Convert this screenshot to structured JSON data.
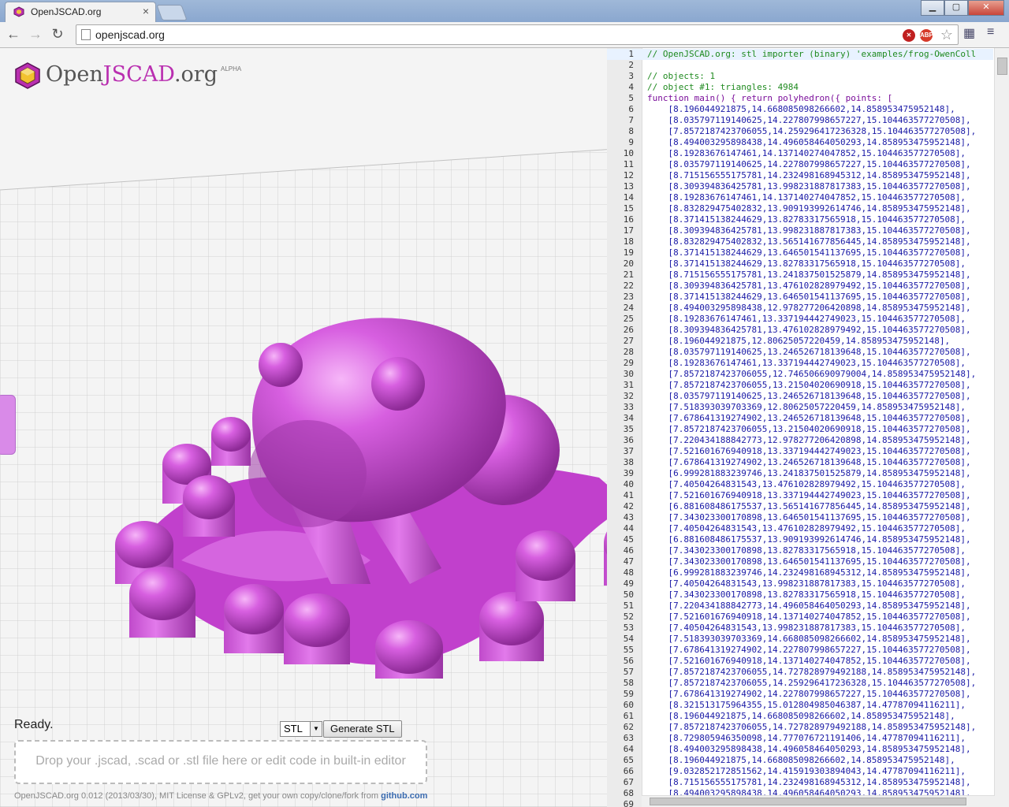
{
  "browser": {
    "tab_title": "OpenJSCAD.org",
    "url": "openjscad.org"
  },
  "logo": {
    "open": "Open",
    "jscad": "JSCAD",
    "org": ".org",
    "badge": "ALPHA"
  },
  "viewer": {
    "status": "Ready.",
    "format_selected": "STL",
    "generate_label": "Generate STL",
    "dropzone_text": "Drop your .jscad, .scad or .stl file here or edit code in built-in editor",
    "footer_text": "OpenJSCAD.org 0.012 (2013/03/30), MIT License & GPLv2, get your own copy/clone/fork from ",
    "footer_link": "github.com"
  },
  "editor": {
    "lines": [
      {
        "n": "1",
        "t": "// OpenJSCAD.org: stl importer (binary) 'examples/frog-OwenColl",
        "c": "comment"
      },
      {
        "n": "2",
        "t": "",
        "c": "plain"
      },
      {
        "n": "3",
        "t": "// objects: 1",
        "c": "comment"
      },
      {
        "n": "4",
        "t": "// object #1: triangles: 4984",
        "c": "comment"
      },
      {
        "n": "5",
        "t": "function main() { return polyhedron({ points: [",
        "c": "kw"
      },
      {
        "n": "6",
        "t": "    [8.196044921875,14.668085098266602,14.858953475952148],",
        "c": "num"
      },
      {
        "n": "7",
        "t": "    [8.035797119140625,14.227807998657227,15.104463577270508],",
        "c": "num"
      },
      {
        "n": "8",
        "t": "    [7.8572187423706055,14.259296417236328,15.104463577270508],",
        "c": "num"
      },
      {
        "n": "9",
        "t": "    [8.494003295898438,14.496058464050293,14.858953475952148],",
        "c": "num"
      },
      {
        "n": "10",
        "t": "    [8.19283676147461,14.137140274047852,15.104463577270508],",
        "c": "num"
      },
      {
        "n": "11",
        "t": "    [8.035797119140625,14.227807998657227,15.104463577270508],",
        "c": "num"
      },
      {
        "n": "12",
        "t": "    [8.715156555175781,14.232498168945312,14.858953475952148],",
        "c": "num"
      },
      {
        "n": "13",
        "t": "    [8.309394836425781,13.998231887817383,15.104463577270508],",
        "c": "num"
      },
      {
        "n": "14",
        "t": "    [8.19283676147461,14.137140274047852,15.104463577270508],",
        "c": "num"
      },
      {
        "n": "15",
        "t": "    [8.832829475402832,13.909193992614746,14.858953475952148],",
        "c": "num"
      },
      {
        "n": "16",
        "t": "    [8.371415138244629,13.82783317565918,15.104463577270508],",
        "c": "num"
      },
      {
        "n": "17",
        "t": "    [8.309394836425781,13.998231887817383,15.104463577270508],",
        "c": "num"
      },
      {
        "n": "18",
        "t": "    [8.832829475402832,13.565141677856445,14.858953475952148],",
        "c": "num"
      },
      {
        "n": "19",
        "t": "    [8.371415138244629,13.646501541137695,15.104463577270508],",
        "c": "num"
      },
      {
        "n": "20",
        "t": "    [8.371415138244629,13.82783317565918,15.104463577270508],",
        "c": "num"
      },
      {
        "n": "21",
        "t": "    [8.715156555175781,13.241837501525879,14.858953475952148],",
        "c": "num"
      },
      {
        "n": "22",
        "t": "    [8.309394836425781,13.476102828979492,15.104463577270508],",
        "c": "num"
      },
      {
        "n": "23",
        "t": "    [8.371415138244629,13.646501541137695,15.104463577270508],",
        "c": "num"
      },
      {
        "n": "24",
        "t": "    [8.494003295898438,12.978277206420898,14.858953475952148],",
        "c": "num"
      },
      {
        "n": "25",
        "t": "    [8.19283676147461,13.337194442749023,15.104463577270508],",
        "c": "num"
      },
      {
        "n": "26",
        "t": "    [8.309394836425781,13.476102828979492,15.104463577270508],",
        "c": "num"
      },
      {
        "n": "27",
        "t": "    [8.196044921875,12.80625057220459,14.858953475952148],",
        "c": "num"
      },
      {
        "n": "28",
        "t": "    [8.035797119140625,13.246526718139648,15.104463577270508],",
        "c": "num"
      },
      {
        "n": "29",
        "t": "    [8.19283676147461,13.337194442749023,15.104463577270508],",
        "c": "num"
      },
      {
        "n": "30",
        "t": "    [7.8572187423706055,12.746506690979004,14.858953475952148],",
        "c": "num"
      },
      {
        "n": "31",
        "t": "    [7.8572187423706055,13.21504020690918,15.104463577270508],",
        "c": "num"
      },
      {
        "n": "32",
        "t": "    [8.035797119140625,13.246526718139648,15.104463577270508],",
        "c": "num"
      },
      {
        "n": "33",
        "t": "    [7.518393039703369,12.80625057220459,14.858953475952148],",
        "c": "num"
      },
      {
        "n": "34",
        "t": "    [7.678641319274902,13.246526718139648,15.104463577270508],",
        "c": "num"
      },
      {
        "n": "35",
        "t": "    [7.8572187423706055,13.21504020690918,15.104463577270508],",
        "c": "num"
      },
      {
        "n": "36",
        "t": "    [7.220434188842773,12.978277206420898,14.858953475952148],",
        "c": "num"
      },
      {
        "n": "37",
        "t": "    [7.521601676940918,13.337194442749023,15.104463577270508],",
        "c": "num"
      },
      {
        "n": "38",
        "t": "    [7.678641319274902,13.246526718139648,15.104463577270508],",
        "c": "num"
      },
      {
        "n": "39",
        "t": "    [6.999281883239746,13.241837501525879,14.858953475952148],",
        "c": "num"
      },
      {
        "n": "40",
        "t": "    [7.40504264831543,13.476102828979492,15.104463577270508],",
        "c": "num"
      },
      {
        "n": "41",
        "t": "    [7.521601676940918,13.337194442749023,15.104463577270508],",
        "c": "num"
      },
      {
        "n": "42",
        "t": "    [6.881608486175537,13.565141677856445,14.858953475952148],",
        "c": "num"
      },
      {
        "n": "43",
        "t": "    [7.343023300170898,13.646501541137695,15.104463577270508],",
        "c": "num"
      },
      {
        "n": "44",
        "t": "    [7.40504264831543,13.476102828979492,15.104463577270508],",
        "c": "num"
      },
      {
        "n": "45",
        "t": "    [6.881608486175537,13.909193992614746,14.858953475952148],",
        "c": "num"
      },
      {
        "n": "46",
        "t": "    [7.343023300170898,13.82783317565918,15.104463577270508],",
        "c": "num"
      },
      {
        "n": "47",
        "t": "    [7.343023300170898,13.646501541137695,15.104463577270508],",
        "c": "num"
      },
      {
        "n": "48",
        "t": "    [6.999281883239746,14.232498168945312,14.858953475952148],",
        "c": "num"
      },
      {
        "n": "49",
        "t": "    [7.40504264831543,13.998231887817383,15.104463577270508],",
        "c": "num"
      },
      {
        "n": "50",
        "t": "    [7.343023300170898,13.82783317565918,15.104463577270508],",
        "c": "num"
      },
      {
        "n": "51",
        "t": "    [7.220434188842773,14.496058464050293,14.858953475952148],",
        "c": "num"
      },
      {
        "n": "52",
        "t": "    [7.521601676940918,14.137140274047852,15.104463577270508],",
        "c": "num"
      },
      {
        "n": "53",
        "t": "    [7.40504264831543,13.998231887817383,15.104463577270508],",
        "c": "num"
      },
      {
        "n": "54",
        "t": "    [7.518393039703369,14.668085098266602,14.858953475952148],",
        "c": "num"
      },
      {
        "n": "55",
        "t": "    [7.678641319274902,14.227807998657227,15.104463577270508],",
        "c": "num"
      },
      {
        "n": "56",
        "t": "    [7.521601676940918,14.137140274047852,15.104463577270508],",
        "c": "num"
      },
      {
        "n": "57",
        "t": "    [7.8572187423706055,14.727828979492188,14.858953475952148],",
        "c": "num"
      },
      {
        "n": "58",
        "t": "    [7.8572187423706055,14.259296417236328,15.104463577270508],",
        "c": "num"
      },
      {
        "n": "59",
        "t": "    [7.678641319274902,14.227807998657227,15.104463577270508],",
        "c": "num"
      },
      {
        "n": "60",
        "t": "    [8.321513175964355,15.012804985046387,14.47787094116211],",
        "c": "num"
      },
      {
        "n": "61",
        "t": "    [8.196044921875,14.668085098266602,14.858953475952148],",
        "c": "num"
      },
      {
        "n": "62",
        "t": "    [7.8572187423706055,14.727828979492188,14.858953475952148],",
        "c": "num"
      },
      {
        "n": "63",
        "t": "    [8.729805946350098,14.777076721191406,14.47787094116211],",
        "c": "num"
      },
      {
        "n": "64",
        "t": "    [8.494003295898438,14.496058464050293,14.858953475952148],",
        "c": "num"
      },
      {
        "n": "65",
        "t": "    [8.196044921875,14.668085098266602,14.858953475952148],",
        "c": "num"
      },
      {
        "n": "66",
        "t": "    [9.032852172851562,14.415919303894043,14.47787094116211],",
        "c": "num"
      },
      {
        "n": "67",
        "t": "    [8.715156555175781,14.232498168945312,14.858953475952148],",
        "c": "num"
      },
      {
        "n": "68",
        "t": "    [8.494003295898438,14.496058464050293,14.858953475952148],",
        "c": "num"
      },
      {
        "n": "69",
        "t": "",
        "c": "plain"
      }
    ]
  },
  "colors": {
    "accent": "#b92fb0",
    "model": "#d455e0"
  }
}
